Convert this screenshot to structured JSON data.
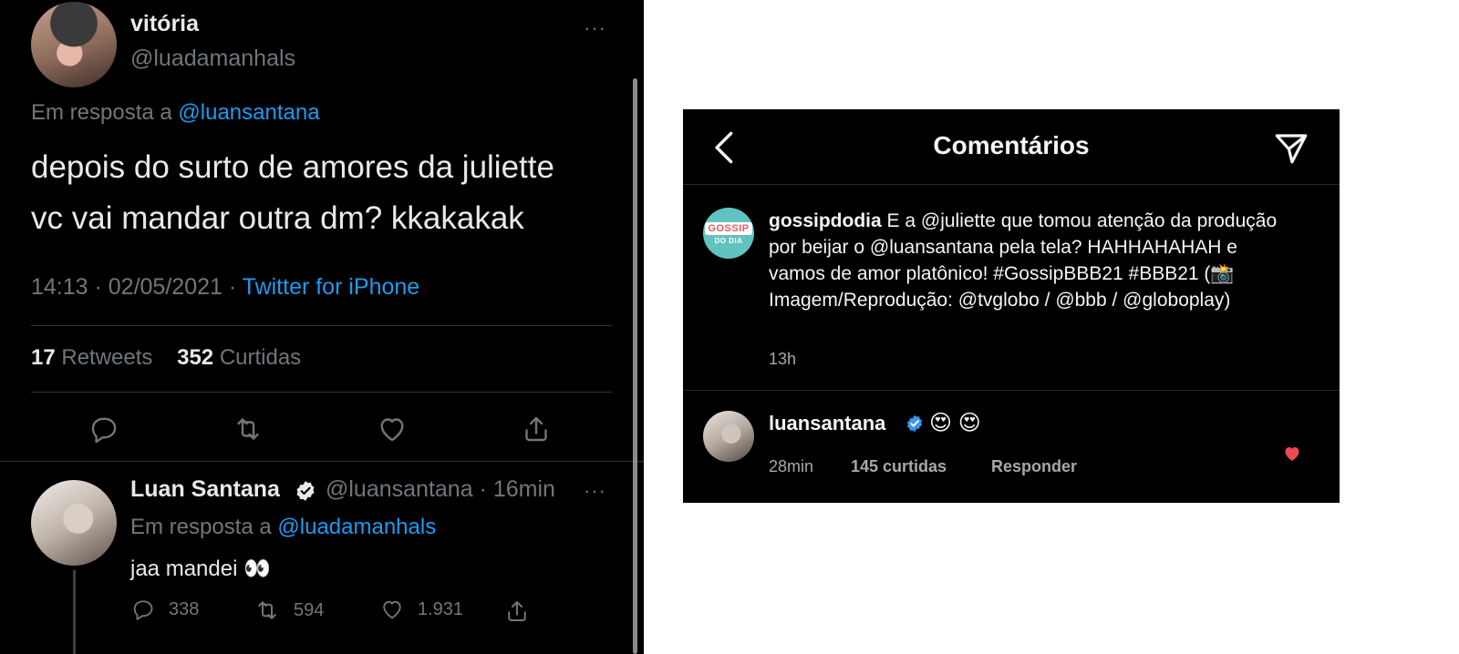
{
  "twitter": {
    "tweet": {
      "display_name": "vitória",
      "handle": "@luadamanhals",
      "reply_prefix": "Em resposta a",
      "reply_to": "@luansantana",
      "text_line1": "depois do surto de amores da juliette",
      "text_line2": "vc vai mandar outra dm? kkakakak",
      "time": "14:13 · 02/05/2021 ·",
      "source": "Twitter for iPhone",
      "retweets_count": "17",
      "retweets_label": "Retweets",
      "likes_count": "352",
      "likes_label": "Curtidas"
    },
    "reply": {
      "display_name": "Luan Santana",
      "handle_time": "@luansantana · 16min",
      "reply_prefix": "Em resposta a",
      "reply_to": "@luadamanhals",
      "text": "jaa mandei 👀",
      "replies": "338",
      "retweets": "594",
      "likes": "1.931"
    },
    "more_glyph": "···"
  },
  "instagram": {
    "title": "Comentários",
    "post": {
      "logo_top": "GOSSIP",
      "logo_bottom": "DO DIA",
      "username": "gossipdodia",
      "caption": "E a @juliette que tomou atenção da produção por beijar o @luansantana pela tela? HAHHAHAHAH e vamos de amor platônico! #GossipBBB21 #BBB21 (📸 Imagem/Reprodução: @tvglobo / @bbb / @globoplay)",
      "time": "13h"
    },
    "comment": {
      "username": "luansantana",
      "emojis": "😍 😍",
      "time": "28min",
      "likes": "145 curtidas",
      "reply_label": "Responder"
    },
    "colors": {
      "heart": "#ed4956",
      "verified": "#3897f0"
    }
  }
}
